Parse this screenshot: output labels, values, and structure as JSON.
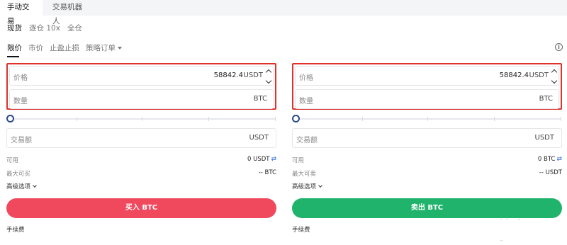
{
  "tabs": [
    {
      "label": "手动交易",
      "active": true
    },
    {
      "label": "交易机器人",
      "active": false
    }
  ],
  "margin_modes": [
    {
      "label": "现货",
      "active": true
    },
    {
      "label": "逐仓 10x",
      "active": false
    },
    {
      "label": "全仓",
      "active": false
    }
  ],
  "order_types": [
    {
      "label": "限价",
      "active": true
    },
    {
      "label": "市价",
      "active": false
    },
    {
      "label": "止盈止损",
      "active": false
    },
    {
      "label": "策略订单",
      "active": false,
      "has_dropdown": true
    }
  ],
  "info_icon": "i",
  "buy": {
    "price_label": "价格",
    "price_value": "58842.4",
    "price_unit": "USDT",
    "qty_label": "数量",
    "qty_value": "",
    "qty_unit": "BTC",
    "slider_percent": 0,
    "amount_label": "交易额",
    "amount_unit": "USDT",
    "available_label": "可用",
    "available_value": "0 USDT",
    "max_label": "最大可买",
    "max_value": "-- BTC",
    "advanced_label": "高级选项",
    "action_label": "买入 BTC",
    "fee_label": "手续费"
  },
  "sell": {
    "price_label": "价格",
    "price_value": "58842.4",
    "price_unit": "USDT",
    "qty_label": "数量",
    "qty_value": "",
    "qty_unit": "BTC",
    "slider_percent": 0,
    "amount_label": "交易额",
    "amount_unit": "USDT",
    "available_label": "可用",
    "available_value": "0 BTC",
    "max_label": "最大可卖",
    "max_value": "-- USDT",
    "advanced_label": "高级选项",
    "action_label": "卖出 BTC",
    "fee_label": "手续费"
  },
  "colors": {
    "buy": "#f0485d",
    "sell": "#1fb36c",
    "highlight_border": "#e0312b",
    "swap_icon": "#2b6cd4"
  }
}
